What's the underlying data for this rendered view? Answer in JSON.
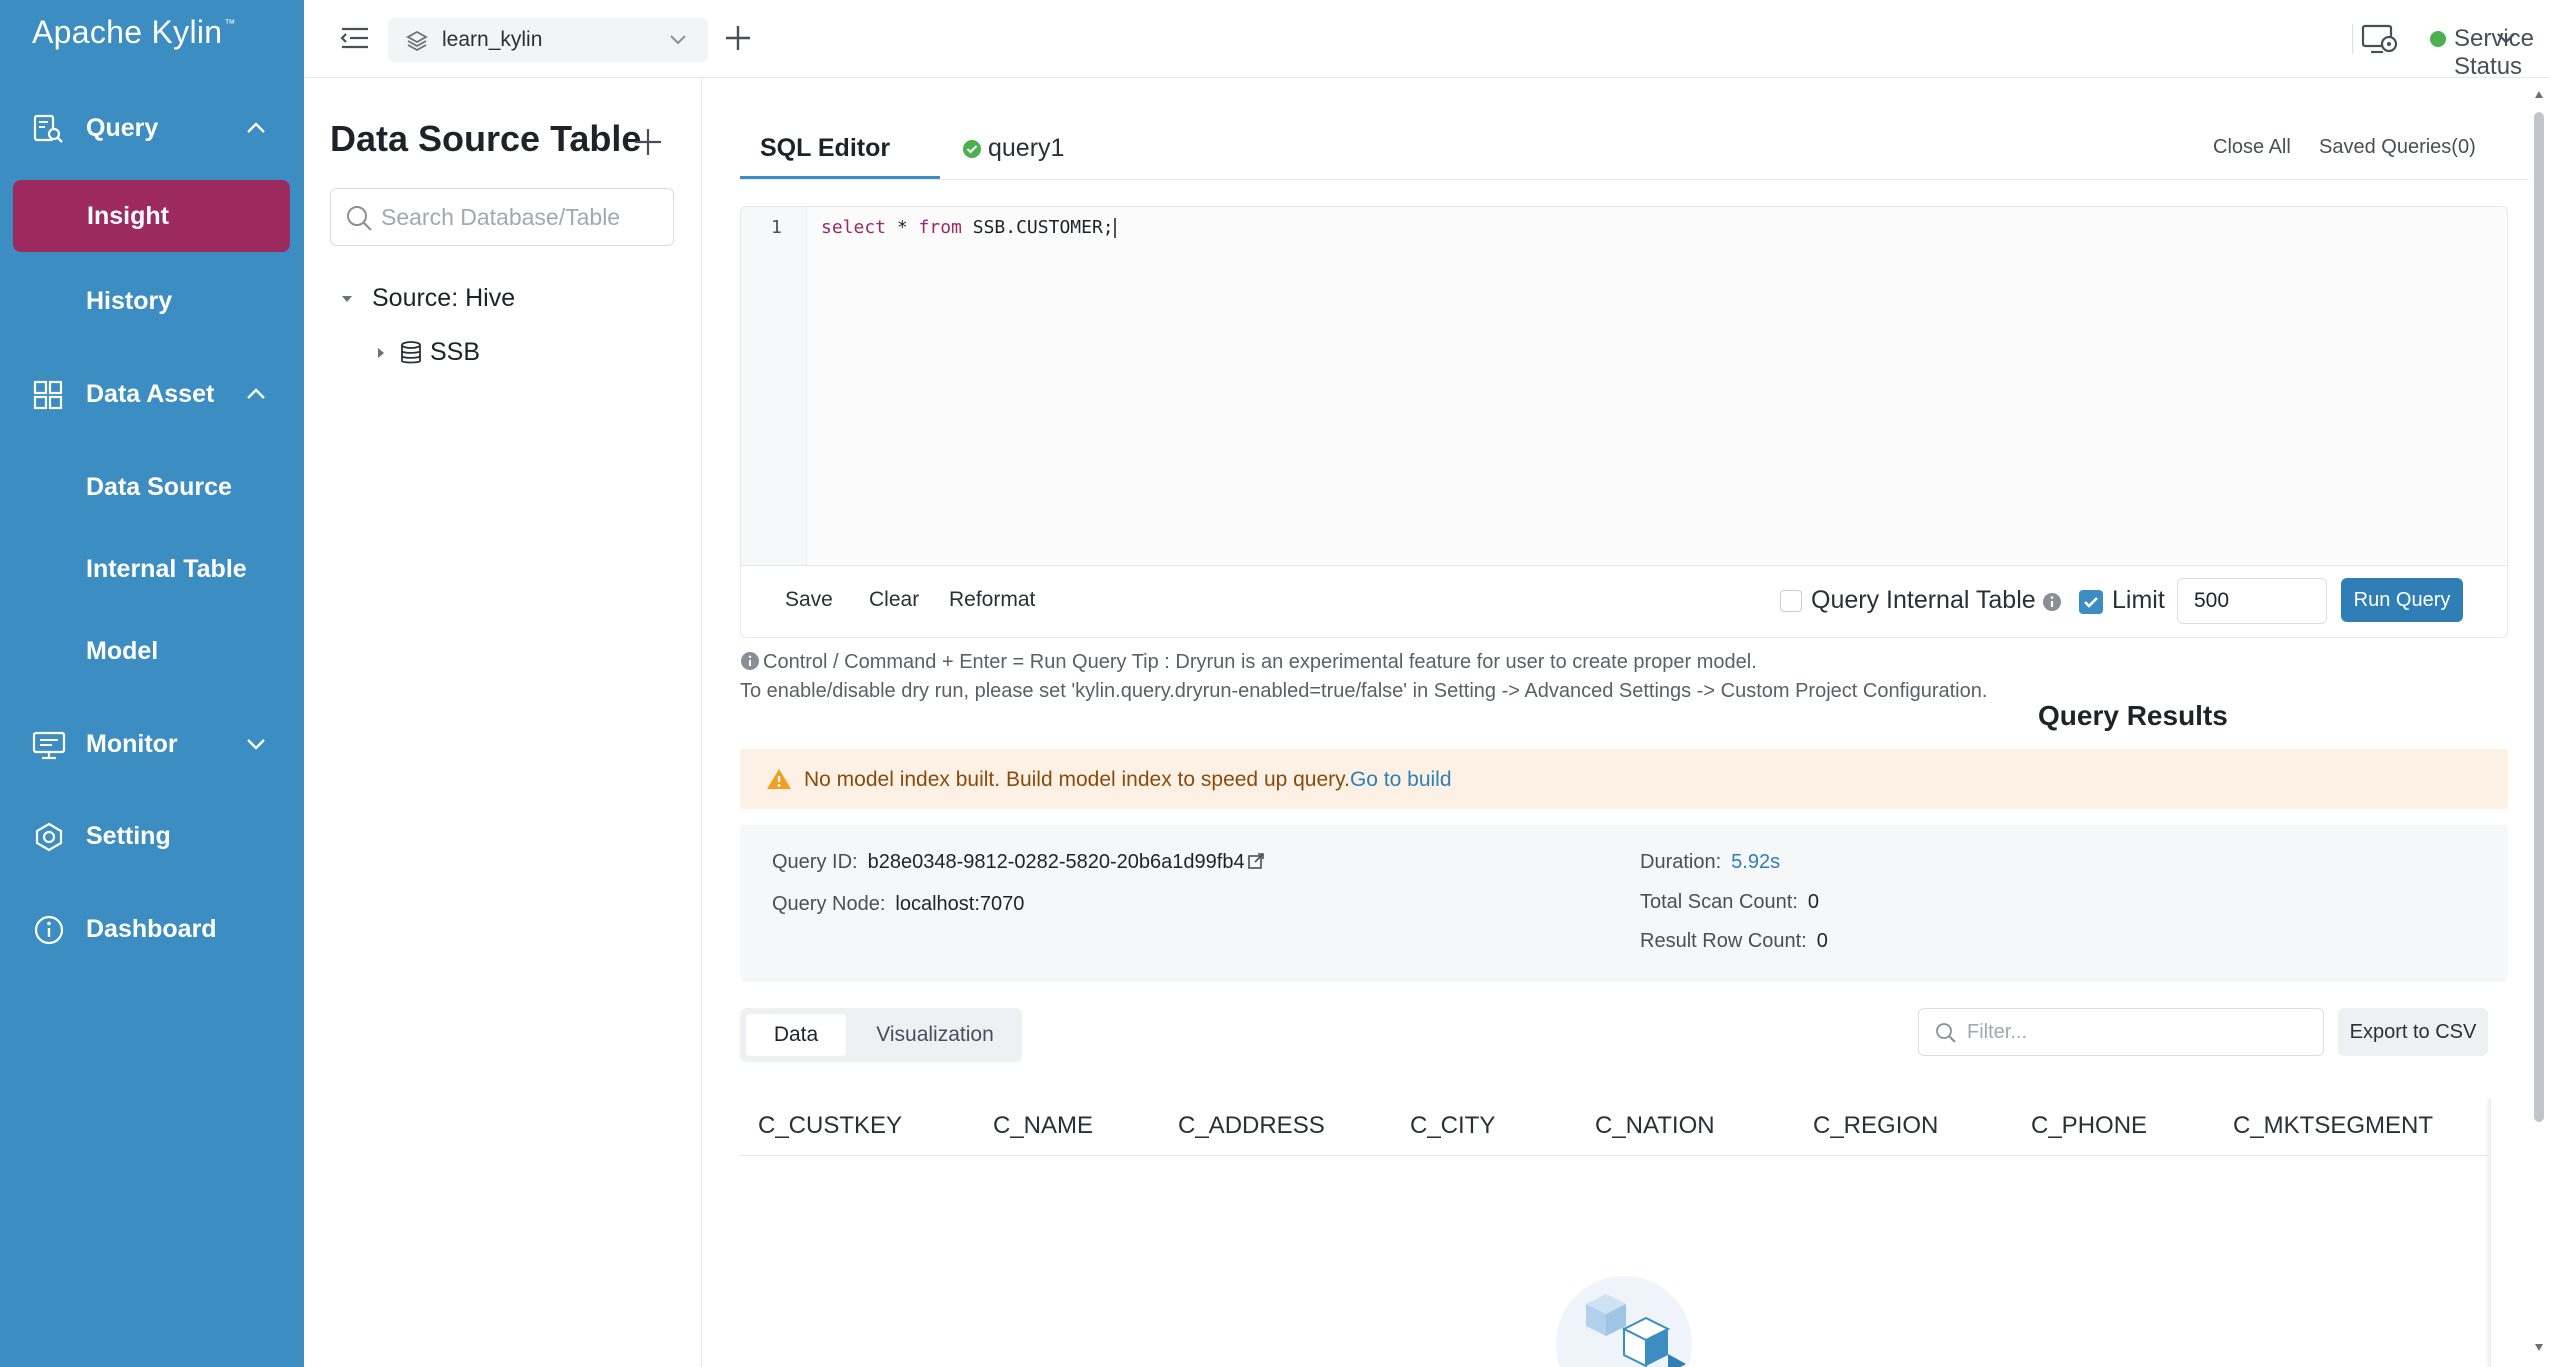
{
  "sidebar": {
    "brand": "Apache Kylin",
    "brand_tm": "™",
    "groups": {
      "query": "Query",
      "data_asset": "Data Asset",
      "monitor": "Monitor",
      "setting": "Setting",
      "dashboard": "Dashboard"
    },
    "items": {
      "insight": "Insight",
      "history": "History",
      "data_source": "Data Source",
      "internal_table": "Internal Table",
      "model": "Model"
    },
    "colors": {
      "background": "#3b8dc2",
      "active": "#9c2a5e"
    }
  },
  "topbar": {
    "project": "learn_kylin",
    "service_status": "Service Status",
    "service_status_color": "#4cb050"
  },
  "left_panel": {
    "title": "Data Source Table",
    "search_placeholder": "Search Database/Table",
    "tree": {
      "root": "Source: Hive",
      "child": "SSB"
    }
  },
  "editor": {
    "tabs": {
      "sql": "SQL Editor",
      "query1": "query1"
    },
    "close_all": "Close All",
    "saved_queries": "Saved Queries(0)",
    "line_number": "1",
    "code": {
      "kw_select": "select",
      "star": " * ",
      "kw_from": "from",
      "table": " SSB.CUSTOMER;"
    },
    "footer": {
      "save": "Save",
      "clear": "Clear",
      "reformat": "Reformat",
      "query_internal_table": "Query Internal Table",
      "limit": "Limit",
      "limit_value": "500",
      "run_query": "Run Query"
    },
    "hint_line1": "Control / Command + Enter = Run Query Tip : Dryrun is an experimental feature for user to create proper model.",
    "hint_line2": "To enable/disable dry run, please set 'kylin.query.dryrun-enabled=true/false' in Setting -> Advanced Settings -> Custom Project Configuration."
  },
  "results": {
    "title": "Query Results",
    "alert_text": "No model index built. Build model index to speed up query.",
    "alert_link": "Go to build",
    "query_id_label": "Query ID:",
    "query_id": "b28e0348-9812-0282-5820-20b6a1d99fb4",
    "query_node_label": "Query Node:",
    "query_node": "localhost:7070",
    "duration_label": "Duration:",
    "duration": "5.92s",
    "total_scan_label": "Total Scan Count:",
    "total_scan": "0",
    "row_count_label": "Result Row Count:",
    "row_count": "0",
    "tabs": {
      "data": "Data",
      "visualization": "Visualization"
    },
    "filter_placeholder": "Filter...",
    "export": "Export to CSV",
    "columns": [
      "C_CUSTKEY",
      "C_NAME",
      "C_ADDRESS",
      "C_CITY",
      "C_NATION",
      "C_REGION",
      "C_PHONE",
      "C_MKTSEGMENT"
    ]
  }
}
